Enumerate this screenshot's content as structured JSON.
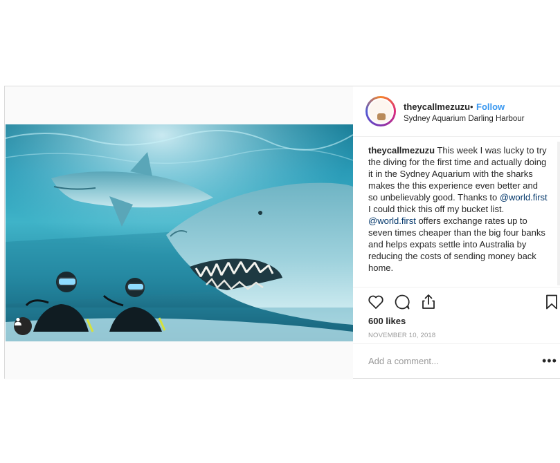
{
  "post": {
    "username": "theycallmezuzu",
    "separator": "•",
    "follow_label": "Follow",
    "location": "Sydney Aquarium Darling Harbour",
    "caption": {
      "username": "theycallmezuzu",
      "text_1": " This week I was lucky to try the diving for the first time and actually doing it in the Sydney Aquarium with the sharks makes the this experience even better and so unbelievably good. Thanks to ",
      "mention_1": "@world.first",
      "text_2": " I could thick this off my bucket list.",
      "mention_2": "@world.first",
      "text_3": " offers exchange rates up to seven times cheaper than the big four banks and helps expats settle into Australia by reducing the costs of sending money back home."
    },
    "likes": "600 likes",
    "date": "NOVEMBER 10, 2018",
    "comment_placeholder": "Add a comment...",
    "more_label": "•••"
  },
  "icons": {
    "like": "heart-icon",
    "comment": "comment-bubble-icon",
    "share": "share-icon",
    "save": "bookmark-icon",
    "user_tag": "user-icon"
  },
  "colors": {
    "follow": "#3897f0",
    "mention": "#003569",
    "muted": "#999999"
  }
}
